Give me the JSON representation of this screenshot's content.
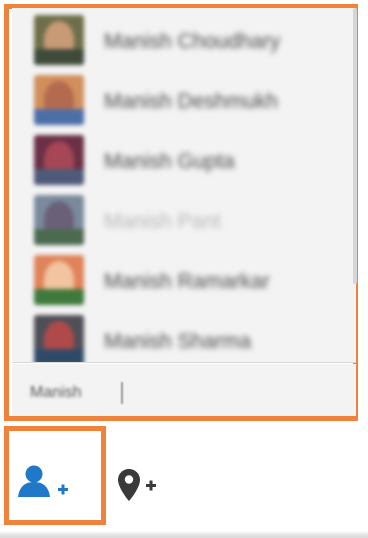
{
  "colors": {
    "highlight_border": "#f0833c",
    "person_icon": "#1f78c8",
    "location_icon": "#3a3a3a",
    "panel_bg": "#f3f3f3"
  },
  "suggestions": [
    {
      "name": "Manish Choudhary",
      "state": "normal"
    },
    {
      "name": "Manish Deshmukh",
      "state": "normal"
    },
    {
      "name": "Manish Gupta",
      "state": "normal"
    },
    {
      "name": "Manish Pant",
      "state": "faded"
    },
    {
      "name": "Manish Ramarkar",
      "state": "normal"
    },
    {
      "name": "Manish Sharma",
      "state": "normal"
    }
  ],
  "input": {
    "value": "Manish"
  },
  "toolbar": {
    "tag_people_icon": "add-person-icon",
    "add_location_icon": "add-location-icon"
  }
}
